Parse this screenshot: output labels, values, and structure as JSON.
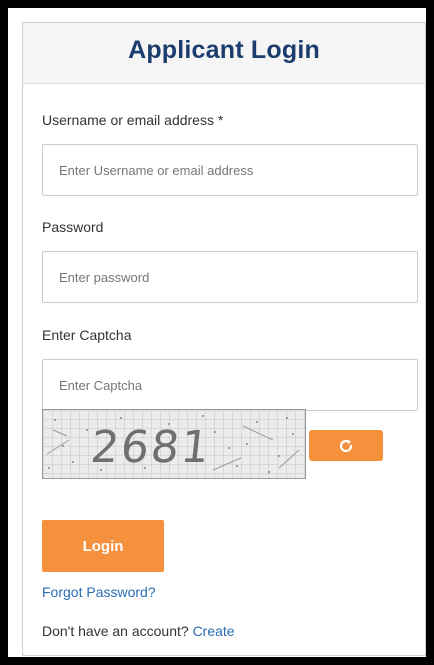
{
  "header": {
    "title": "Applicant Login"
  },
  "form": {
    "username_label": "Username or email address *",
    "username_placeholder": "Enter Username or email address",
    "password_label": "Password",
    "password_placeholder": "Enter password",
    "captcha_label": "Enter Captcha",
    "captcha_placeholder": "Enter Captcha",
    "captcha_image_text": "2681",
    "refresh_icon": "refresh-icon",
    "login_label": "Login",
    "forgot_password_label": "Forgot Password?",
    "signup_prompt": "Don't have an account?",
    "create_label": "Create"
  },
  "colors": {
    "title": "#1b3d6e",
    "accent": "#f5913c",
    "link": "#2a6db3",
    "frame": "#000000"
  }
}
